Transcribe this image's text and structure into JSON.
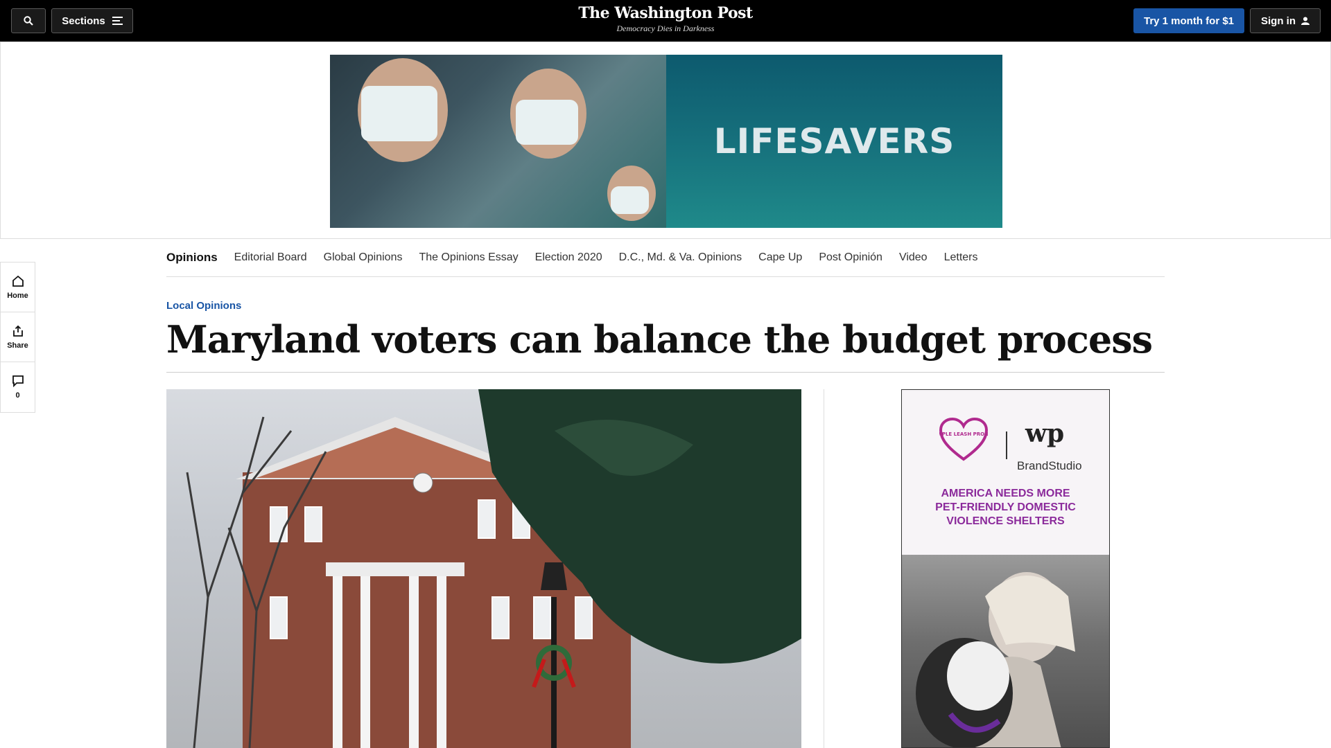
{
  "topbar": {
    "search_label": "",
    "sections_label": "Sections",
    "logo": "The Washington Post",
    "tagline": "Democracy Dies in Darkness",
    "try_label": "Try 1 month for $1",
    "signin_label": "Sign in"
  },
  "ad_banner": {
    "headline": "LIFESAVERS"
  },
  "rail": {
    "home_label": "Home",
    "share_label": "Share",
    "comments_count": "0"
  },
  "section_nav": {
    "items": [
      "Opinions",
      "Editorial Board",
      "Global Opinions",
      "The Opinions Essay",
      "Election 2020",
      "D.C., Md. & Va. Opinions",
      "Cape Up",
      "Post Opinión",
      "Video",
      "Letters"
    ]
  },
  "article": {
    "kicker": "Local Opinions",
    "headline": "Maryland voters can balance the budget process"
  },
  "side_ad": {
    "brand_logo_text": "PURPLE LEASH PROJECT",
    "wp_logo": "wp",
    "brandstudio": "BrandStudio",
    "copy_line1": "AMERICA NEEDS MORE",
    "copy_line2": "PET-FRIENDLY DOMESTIC",
    "copy_line3": "VIOLENCE SHELTERS"
  },
  "colors": {
    "accent_blue": "#1955a5",
    "topbar_bg": "#000000",
    "ad_purple": "#8b2a9b"
  }
}
